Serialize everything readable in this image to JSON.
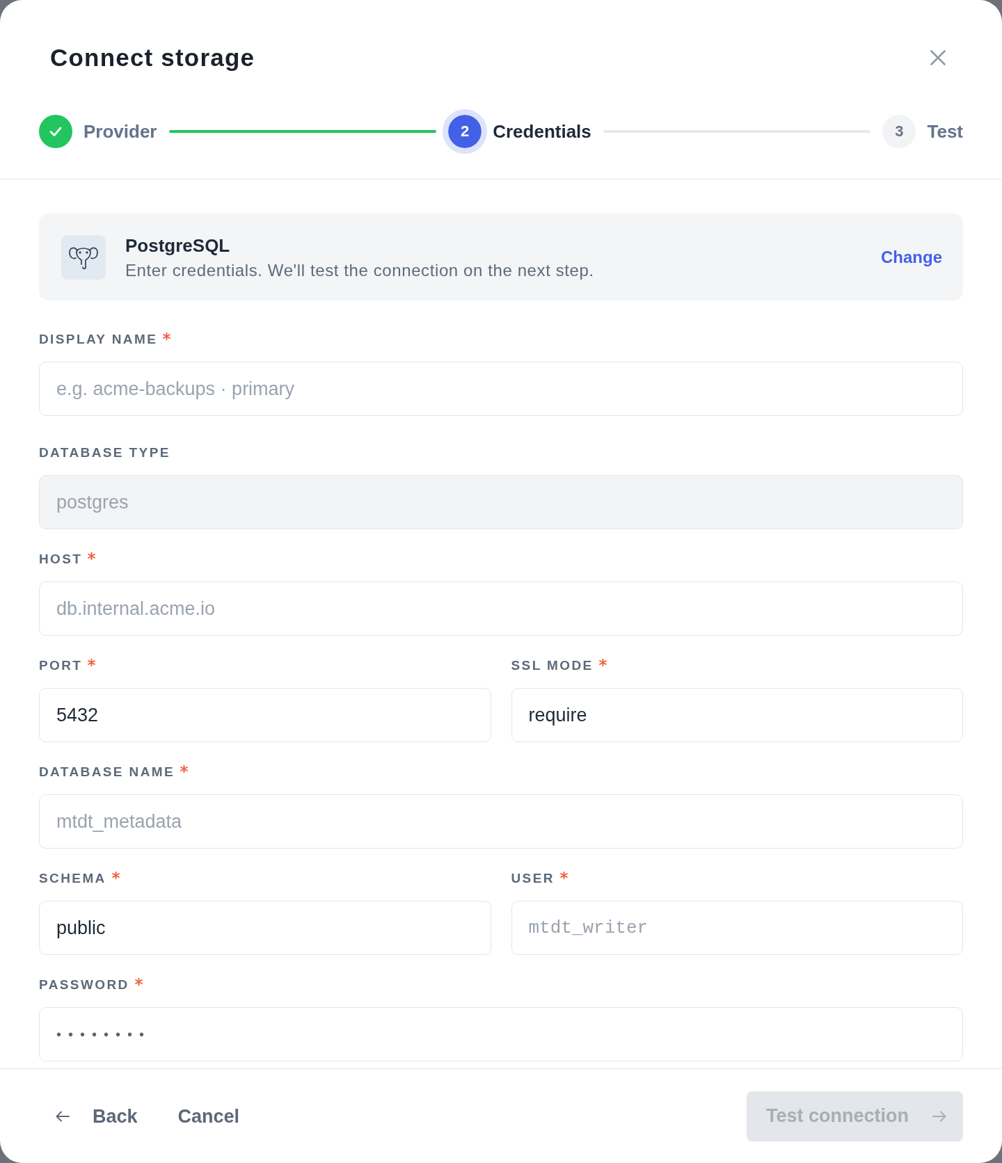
{
  "header": {
    "title": "Connect storage"
  },
  "stepper": {
    "steps": [
      {
        "label": "Provider",
        "done": true,
        "active": false
      },
      {
        "number": "2",
        "label": "Credentials",
        "done": false,
        "active": true
      },
      {
        "number": "3",
        "label": "Test",
        "done": false,
        "active": false
      }
    ]
  },
  "provider": {
    "name": "PostgreSQL",
    "description": "Enter credentials. We'll test the connection on the next step.",
    "action": "Change"
  },
  "form": {
    "rows": [
      {
        "fields": [
          {
            "label": "DISPLAY NAME",
            "required": true,
            "kind": "text",
            "placeholder": "e.g. acme-backups · primary",
            "disabled": false
          }
        ]
      },
      {
        "fields": [
          {
            "label": "DATABASE TYPE",
            "required": false,
            "kind": "text",
            "value": "postgres",
            "disabled": true
          }
        ]
      },
      {
        "fields": [
          {
            "label": "HOST",
            "required": true,
            "kind": "text",
            "placeholder": "db.internal.acme.io",
            "disabled": false
          }
        ]
      },
      {
        "fields": [
          {
            "label": "PORT",
            "required": true,
            "kind": "text",
            "value": "5432",
            "disabled": false
          },
          {
            "label": "SSL MODE",
            "required": true,
            "kind": "text",
            "value": "require",
            "disabled": false
          }
        ]
      },
      {
        "fields": [
          {
            "label": "DATABASE NAME",
            "required": true,
            "kind": "text",
            "placeholder": "mtdt_metadata",
            "disabled": false
          }
        ]
      },
      {
        "fields": [
          {
            "label": "SCHEMA",
            "required": true,
            "kind": "text",
            "value": "public",
            "disabled": false
          },
          {
            "label": "USER",
            "required": true,
            "kind": "username",
            "placeholder": "mtdt_writer",
            "disabled": false
          }
        ]
      },
      {
        "fields": [
          {
            "label": "PASSWORD",
            "required": true,
            "kind": "password",
            "value": "••••••••",
            "disabled": false
          }
        ]
      }
    ]
  },
  "footer": {
    "back": "Back",
    "cancel": "Cancel",
    "submit": {
      "label": "Test connection",
      "disabled": true
    }
  }
}
